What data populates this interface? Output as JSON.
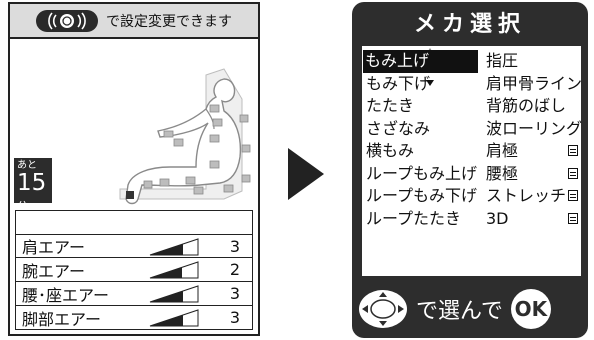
{
  "left_screen": {
    "hint": "で設定変更できます",
    "timer": {
      "prefix": "あと",
      "value": "15",
      "unit": "分"
    },
    "air_rows": [
      {
        "label": "肩エアー",
        "value": "3"
      },
      {
        "label": "腕エアー",
        "value": "2"
      },
      {
        "label": "腰･座エアー",
        "value": "3"
      },
      {
        "label": "脚部エアー",
        "value": "3"
      }
    ]
  },
  "right_screen": {
    "title": "メカ選択",
    "left_column": [
      "もみ上げ",
      "もみ下げ",
      "たたき",
      "さざなみ",
      "横もみ",
      "ループもみ上げ",
      "ループもみ下げ",
      "ループたたき"
    ],
    "right_column": [
      "指圧",
      "肩甲骨ライン",
      "背筋のばし",
      "波ローリング",
      "肩極",
      "腰極",
      "ストレッチ",
      "3D"
    ],
    "selected": "もみ上げ",
    "footer": {
      "text": "で選んで",
      "ok": "OK"
    }
  }
}
